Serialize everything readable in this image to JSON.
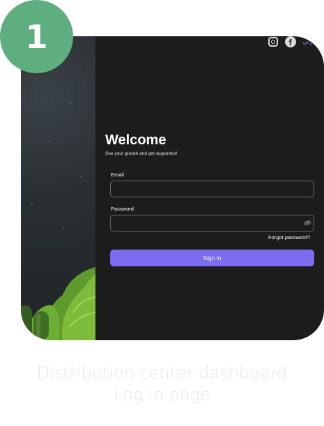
{
  "step": {
    "number": "1"
  },
  "header": {
    "social_icons": [
      "instagram-icon",
      "facebook-icon"
    ],
    "facebook_glyph": "f",
    "language_label": "عربي"
  },
  "login": {
    "title": "Welcome",
    "subtitle": "See your growth and get supported!",
    "email_label": "Email",
    "email_value": "",
    "password_label": "Password",
    "password_value": "",
    "forgot_password": "Forgot password?",
    "signin_label": "Sign in"
  },
  "caption": {
    "line1": "Distribution center dashboard",
    "line2": "Log in page"
  },
  "colors": {
    "badge": "#5fae7f",
    "screen_bg": "#1c1c1c",
    "primary_button": "#7b6cf0",
    "language_link": "#7b8cff"
  }
}
